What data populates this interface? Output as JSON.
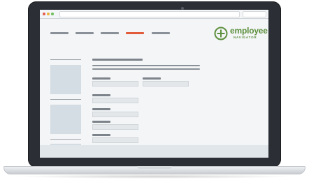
{
  "app": {
    "logo_word": "employee",
    "logo_sub": "NAVIGATOR"
  },
  "nav": {
    "active_index": 3,
    "items": [
      "",
      "",
      "",
      "",
      ""
    ]
  },
  "colors": {
    "accent": "#e25b3a",
    "brand": "#5c8f3c",
    "device": "#2b2e34"
  },
  "icons": {
    "logo_mark": "compass-plus-icon"
  }
}
